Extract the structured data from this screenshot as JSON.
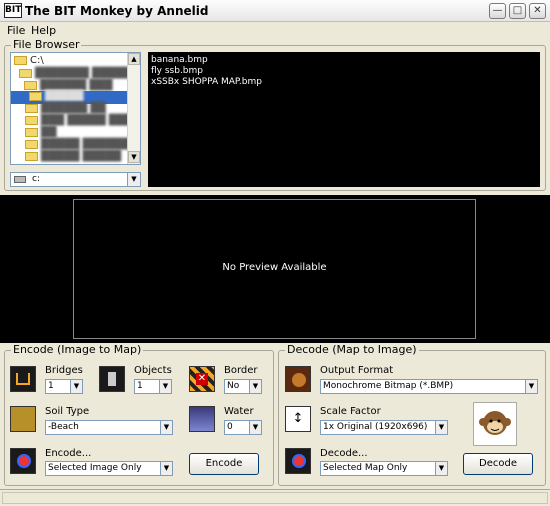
{
  "window": {
    "title": "The BIT Monkey by Annelid",
    "icon": "BIT"
  },
  "menu": {
    "items": [
      "File",
      "Help"
    ]
  },
  "file_browser": {
    "title": "File Browser",
    "tree_root": "C:\\",
    "drive": "c:",
    "files": [
      "banana.bmp",
      "fly ssb.bmp",
      "xSSBx SHOPPA MAP.bmp"
    ]
  },
  "preview": {
    "text": "No Preview Available"
  },
  "encode": {
    "title": "Encode (Image to Map)",
    "bridges_label": "Bridges",
    "bridges_value": "1",
    "objects_label": "Objects",
    "objects_value": "1",
    "border_label": "Border",
    "border_value": "No",
    "soil_label": "Soil Type",
    "soil_value": "-Beach",
    "water_label": "Water",
    "water_value": "0",
    "encode_label": "Encode...",
    "encode_value": "Selected Image Only",
    "encode_button": "Encode"
  },
  "decode": {
    "title": "Decode (Map to Image)",
    "output_label": "Output Format",
    "output_value": "Monochrome Bitmap (*.BMP)",
    "scale_label": "Scale Factor",
    "scale_value": "1x Original (1920x696)",
    "decode_label": "Decode...",
    "decode_value": "Selected Map Only",
    "decode_button": "Decode"
  }
}
